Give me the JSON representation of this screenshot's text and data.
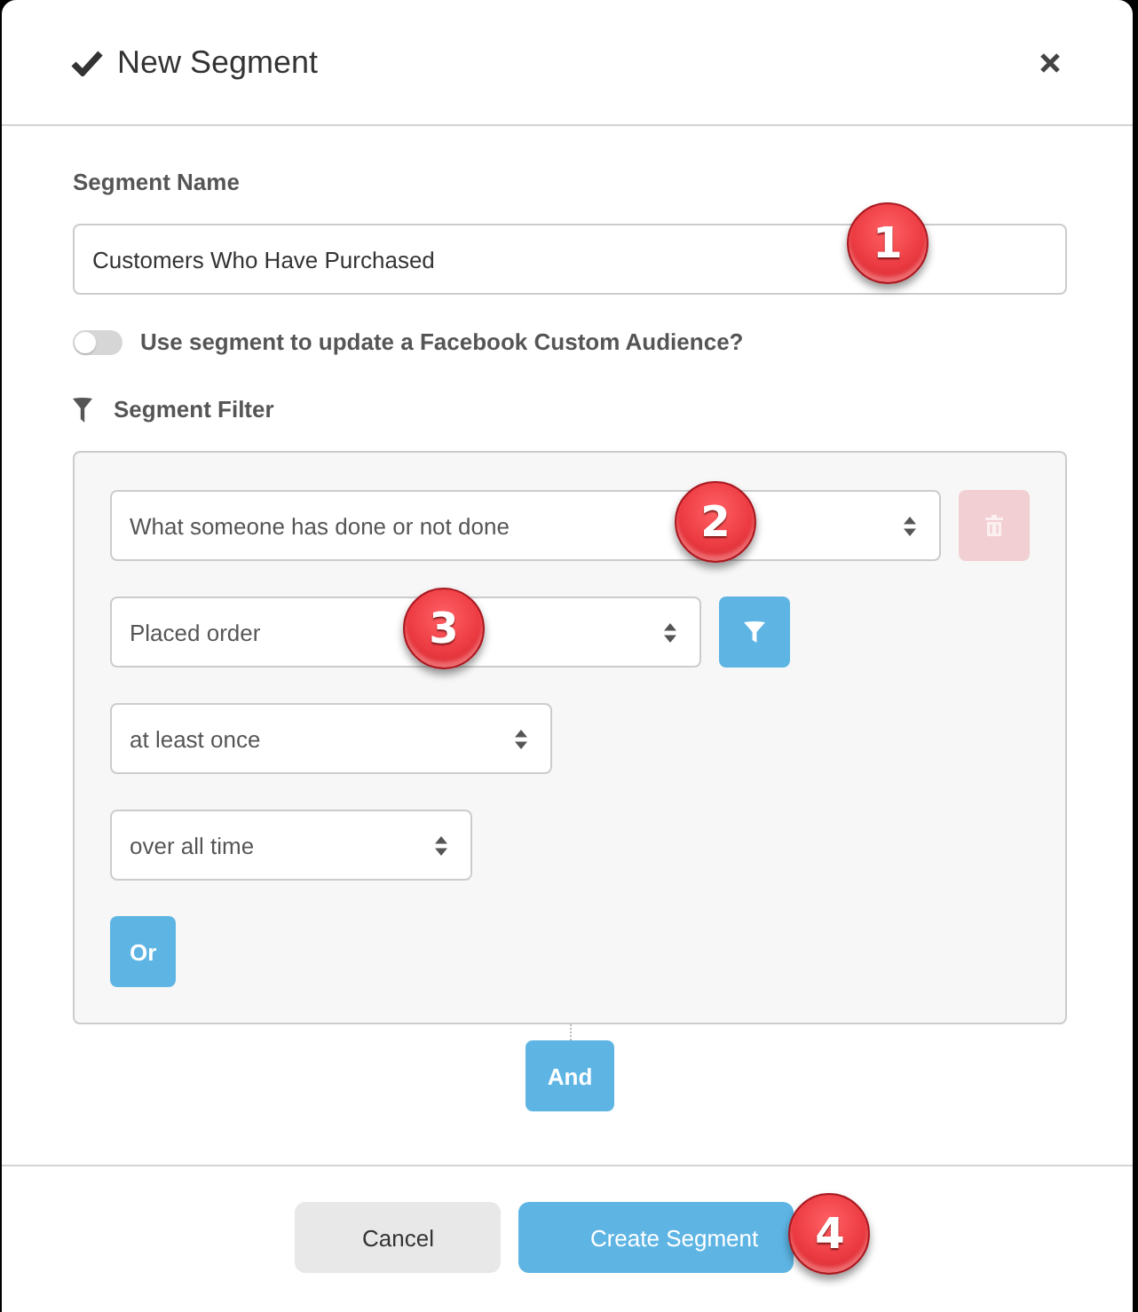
{
  "dialog": {
    "title": "New Segment"
  },
  "segment_name": {
    "label": "Segment Name",
    "value": "Customers Who Have Purchased",
    "callout": "1"
  },
  "facebook_toggle": {
    "label": "Use segment to update a Facebook Custom Audience?",
    "on": false
  },
  "segment_filter": {
    "label": "Segment Filter",
    "conditions": [
      {
        "value": "What someone has done or not done",
        "action": {
          "kind": "delete",
          "disabled": true
        },
        "callout": "2"
      },
      {
        "value": "Placed order",
        "action": {
          "kind": "filter",
          "disabled": false
        },
        "callout": "3"
      },
      {
        "value": "at least once"
      },
      {
        "value": "over all time"
      }
    ],
    "or_button": "Or"
  },
  "and_button": "And",
  "footer": {
    "buttons": [
      {
        "label": "Cancel",
        "kind": "secondary"
      },
      {
        "label": "Create Segment",
        "kind": "primary",
        "callout": "4"
      }
    ]
  }
}
